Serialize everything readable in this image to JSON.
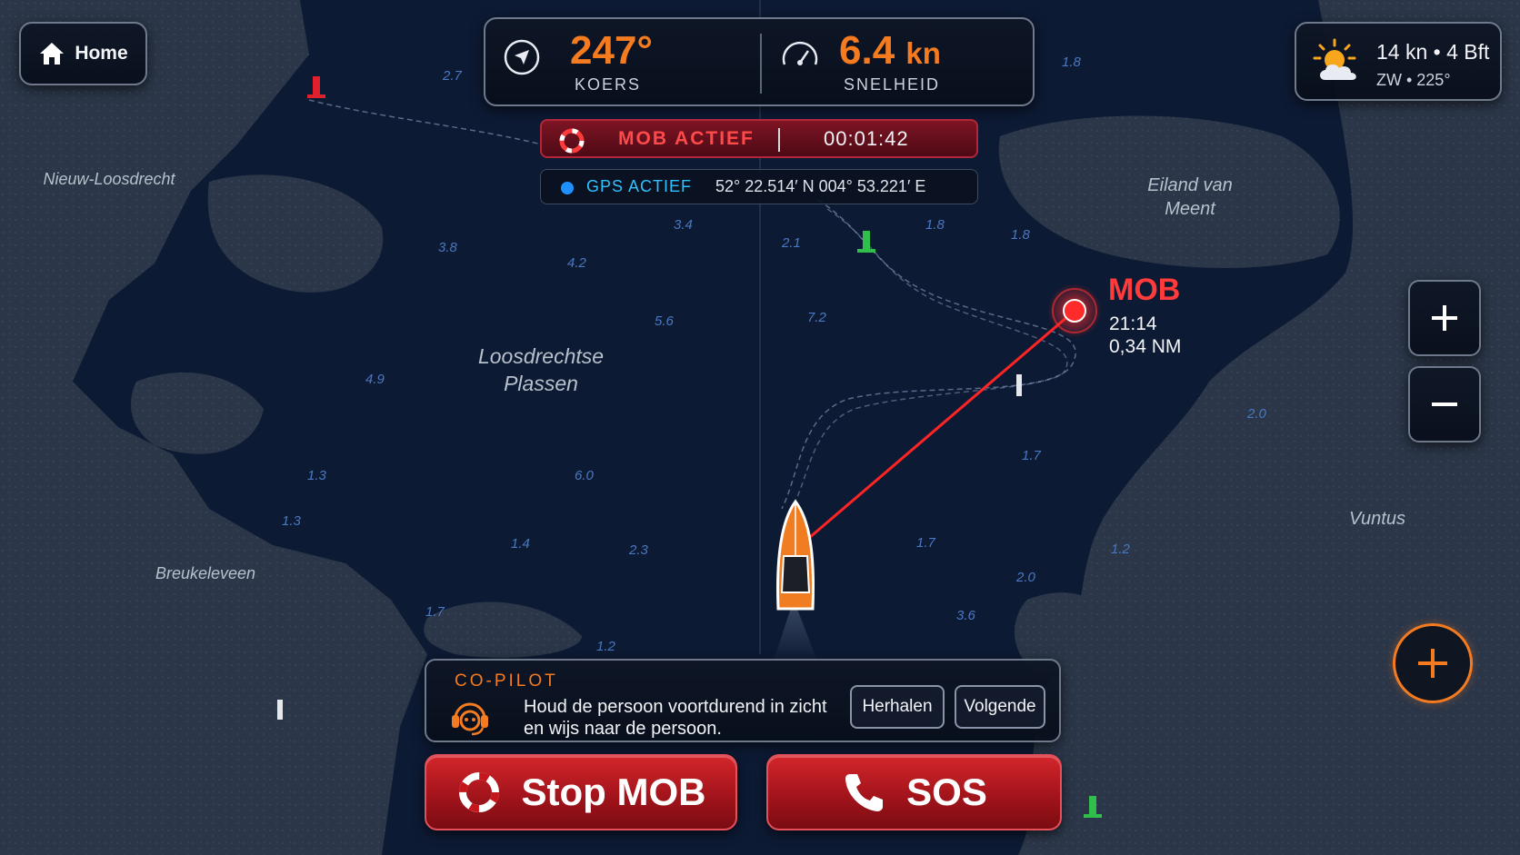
{
  "home": {
    "label": "Home"
  },
  "navigation": {
    "heading": {
      "value": "247°",
      "label": "KOERS"
    },
    "speed": {
      "value": "6.4",
      "unit": "kn",
      "label": "SNELHEID"
    }
  },
  "mob_status": {
    "label": "MOB ACTIEF",
    "timer": "00:01:42"
  },
  "gps": {
    "label": "GPS ACTIEF",
    "coordinates": "52° 22.514′ N   004° 53.221′ E"
  },
  "weather": {
    "wind": "14 kn • 4 Bft",
    "direction": "ZW • 225°",
    "icon": "partly-cloudy-sun-icon"
  },
  "zoom": {
    "in": "+",
    "out": "−"
  },
  "mob_marker": {
    "label": "MOB",
    "time": "21:14",
    "distance": "0,34 NM"
  },
  "map": {
    "places": [
      {
        "name": "Nieuw-Loosdrecht"
      },
      {
        "name": "Breukeleveen"
      },
      {
        "name": "Loosdrechtse"
      },
      {
        "name": "Plassen"
      },
      {
        "name": "Eiland van"
      },
      {
        "name": "Meent"
      },
      {
        "name": "Vuntus"
      }
    ],
    "depths": [
      "2.7",
      "1.8",
      "3.8",
      "4.2",
      "3.4",
      "2.1",
      "1.8",
      "1.8",
      "5.6",
      "7.2",
      "4.9",
      "2.0",
      "1.3",
      "6.0",
      "1.7",
      "1.3",
      "1.4",
      "2.3",
      "1.7",
      "1.2",
      "2.0",
      "1.7",
      "3.6",
      "1.2"
    ]
  },
  "copilot": {
    "title": "CO-PILOT",
    "message_line1": "Houd de persoon voortdurend in zicht",
    "message_line2": "en wijs naar de persoon.",
    "repeat": "Herhalen",
    "next": "Volgende"
  },
  "actions": {
    "stop_mob": "Stop MOB",
    "sos": "SOS"
  },
  "colors": {
    "accent": "#f47b20",
    "alert": "#ff3b3b",
    "gps": "#2fc2ff",
    "water": "#0d1a33",
    "land": "#2a3547"
  }
}
